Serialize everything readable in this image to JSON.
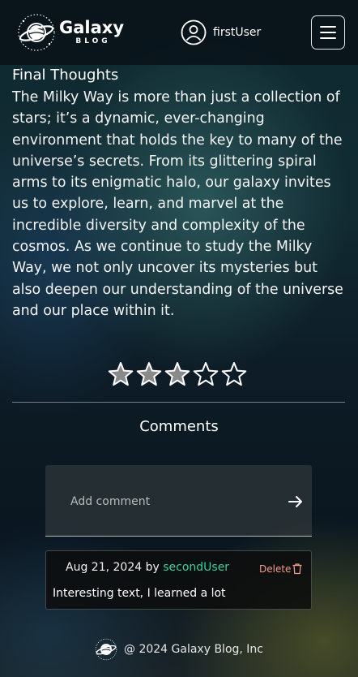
{
  "header": {
    "logo_title": "Galaxy",
    "logo_subtitle": "BLOG",
    "username": "firstUser",
    "logo_icon": "planet-logo-icon",
    "user_icon": "user-circle-icon",
    "menu_icon": "hamburger-menu-icon"
  },
  "article": {
    "section_title": "Final Thoughts",
    "body": "The Milky Way is more than just a collection of stars; it’s a dynamic, ever-changing environment that holds the key to many of the universe’s secrets. From its glittering spiral arms to its enigmatic halo, our galaxy invites us to explore, learn, and marvel at the incredible diversity and complexity of the cosmos. As we continue to study the Milky Way, we not only uncover its mysteries but also deepen our understanding of the universe and our place within it."
  },
  "rating": {
    "value": 3,
    "max": 5,
    "star_icon": "star-icon",
    "filled_color": "#8a8a8a",
    "empty_color": "transparent"
  },
  "comments": {
    "title": "Comments",
    "input_placeholder": "Add comment",
    "input_value": "",
    "send_icon": "arrow-right-icon",
    "items": [
      {
        "date": "Aug 21, 2024",
        "by": "by",
        "author": "secondUser",
        "author_color": "#37d39e",
        "delete_label": "Delete",
        "delete_color": "#f29a8a",
        "text": "Interesting text, I learned a lot"
      }
    ]
  },
  "footer": {
    "text": "@ 2024 Galaxy Blog, Inc"
  }
}
